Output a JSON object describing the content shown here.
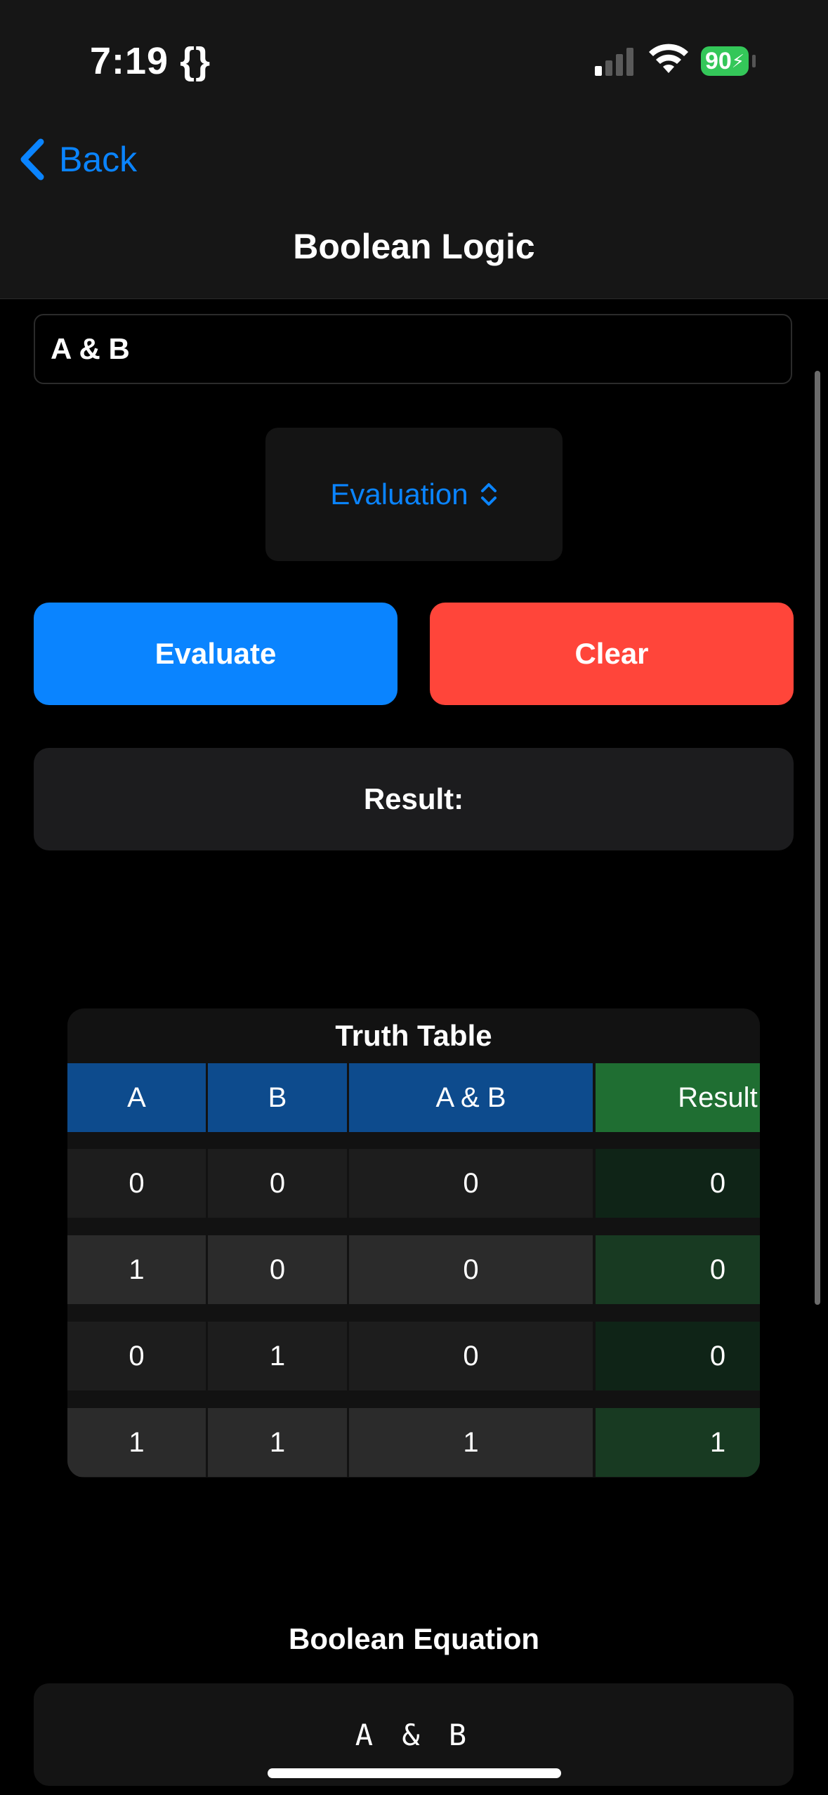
{
  "status_bar": {
    "time": "7:19",
    "time_icon": "{}",
    "battery": "90"
  },
  "nav": {
    "back_label": "Back",
    "title": "Boolean Logic"
  },
  "expression": {
    "value": "A & B"
  },
  "mode_picker": {
    "selected": "Evaluation"
  },
  "actions": {
    "evaluate_label": "Evaluate",
    "clear_label": "Clear"
  },
  "result": {
    "label": "Result:"
  },
  "truth_table": {
    "title": "Truth Table",
    "columns": [
      "A",
      "B",
      "A & B",
      "Result"
    ],
    "rows": [
      [
        "0",
        "0",
        "0",
        "0"
      ],
      [
        "1",
        "0",
        "0",
        "0"
      ],
      [
        "0",
        "1",
        "0",
        "0"
      ],
      [
        "1",
        "1",
        "1",
        "1"
      ]
    ]
  },
  "equation": {
    "title": "Boolean Equation",
    "value": "A & B"
  },
  "colors": {
    "accent": "#0a84ff",
    "destructive": "#ff453a",
    "header_blue": "#0d4b8d",
    "header_green": "#1f6e32",
    "battery_green": "#34c759"
  }
}
